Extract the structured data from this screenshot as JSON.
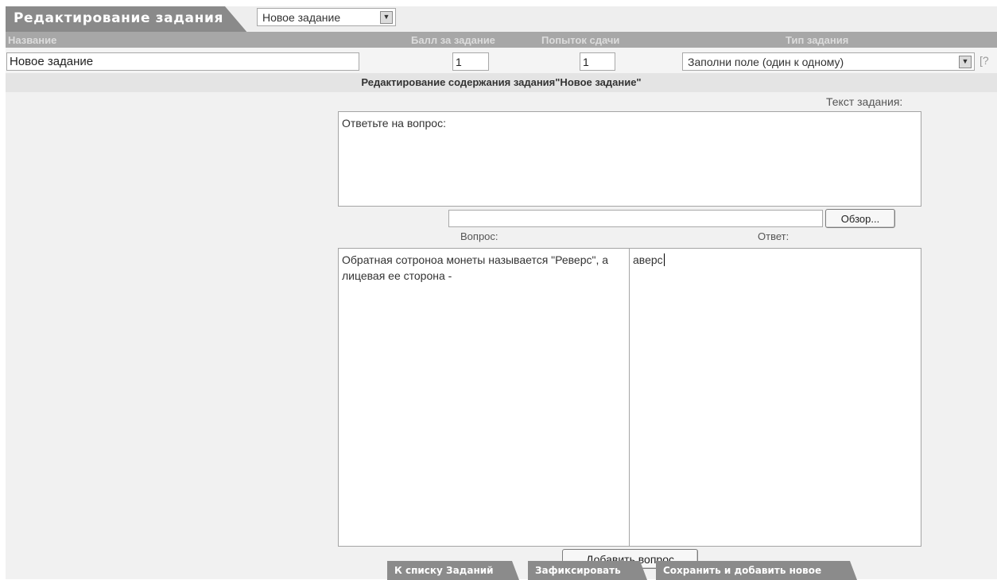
{
  "header": {
    "title": "Редактирование задания",
    "task_select": "Новое задание"
  },
  "columns": {
    "name": "Название",
    "points": "Балл за задание",
    "attempts": "Попыток сдачи",
    "type": "Тип задания"
  },
  "fields": {
    "name_value": "Новое задание",
    "points_value": "1",
    "attempts_value": "1",
    "type_value": "Заполни поле (один к одному)",
    "help_mark": "[?"
  },
  "section": {
    "title": "Редактирование содержания задания\"Новое задание\""
  },
  "content": {
    "task_text_label": "Текст задания:",
    "task_text_value": "Ответьте на вопрос:",
    "file_input_value": "",
    "browse_label": "Обзор...",
    "question_label": "Вопрос:",
    "answer_label": "Ответ:",
    "question_value": "Обратная сотроноа монеты называется \"Реверс\", а лицевая ее сторона -",
    "answer_value": "аверс",
    "add_question_label": "Добавить вопрос"
  },
  "footer": {
    "back_label": "К списку Заданий",
    "fix_label": "Зафиксировать",
    "save_new_label": "Сохранить и добавить новое"
  }
}
